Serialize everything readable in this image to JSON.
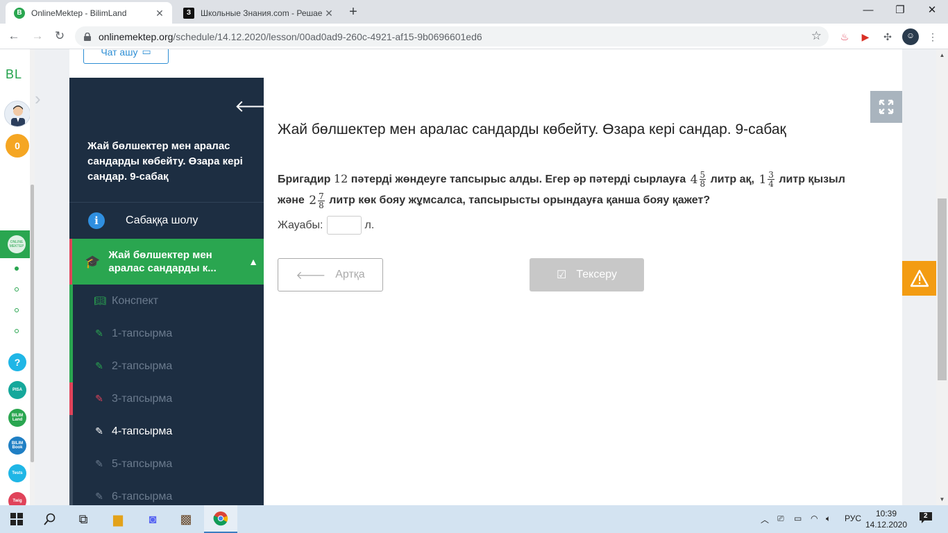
{
  "browser": {
    "tabs": [
      {
        "title": "OnlineMektep - BilimLand",
        "favicon": "B",
        "favicon_color": "#2aa650",
        "active": true
      },
      {
        "title": "Школьные Знания.com - Решае",
        "favicon": "З",
        "favicon_color": "#111111",
        "active": false
      }
    ],
    "url_host": "onlinemektep.org",
    "url_path": "/schedule/14.12.2020/lesson/00ad0ad9-260c-4921-af15-9b0696601ed6"
  },
  "rail": {
    "logo": "BL",
    "coins": "0",
    "help": "?",
    "apps": [
      "PISA",
      "BILIM Land",
      "BILIM Book",
      "Tests",
      "Twig"
    ],
    "active_app": "ONLINE MEKTEP"
  },
  "chat_button": "Чат ашу",
  "sidebar": {
    "lesson_title": "Жай бөлшектер мен аралас сандарды көбейту. Өзара кері сандар. 9-сабақ",
    "overview": "Сабаққа шолу",
    "section_label": "Жай бөлшектер мен аралас сандарды к...",
    "items": [
      {
        "label": "Конспект",
        "state": "done"
      },
      {
        "label": "1-тапсырма",
        "state": "done"
      },
      {
        "label": "2-тапсырма",
        "state": "done"
      },
      {
        "label": "3-тапсырма",
        "state": "wrong"
      },
      {
        "label": "4-тапсырма",
        "state": "current"
      },
      {
        "label": "5-тапсырма",
        "state": "pending"
      },
      {
        "label": "6-тапсырма",
        "state": "pending"
      }
    ]
  },
  "content": {
    "title": "Жай бөлшектер мен аралас сандарды көбейту. Өзара кері сандар. 9-сабақ",
    "q_part1": "Бригадир",
    "q_num12": "12",
    "q_part2": "пәтерді жөндеуге тапсырыс алды. Егер әр пәтерді сырлауға",
    "frac1": {
      "whole": "4",
      "num": "5",
      "den": "8"
    },
    "q_part3": "литр ақ,",
    "frac2": {
      "whole": "1",
      "num": "3",
      "den": "4"
    },
    "q_part4": "литр қызыл",
    "q_part5": "және",
    "frac3": {
      "whole": "2",
      "num": "7",
      "den": "8"
    },
    "q_part6": "литр көк бояу жұмсалса, тапсырысты орындауға қанша бояу қажет?",
    "answer_label": "Жауабы:",
    "answer_value": "",
    "answer_unit": "л.",
    "back_button": "Артқа",
    "check_button": "Тексеру"
  },
  "taskbar": {
    "language": "РУС",
    "time": "10:39",
    "date": "14.12.2020",
    "notifications": "2"
  }
}
